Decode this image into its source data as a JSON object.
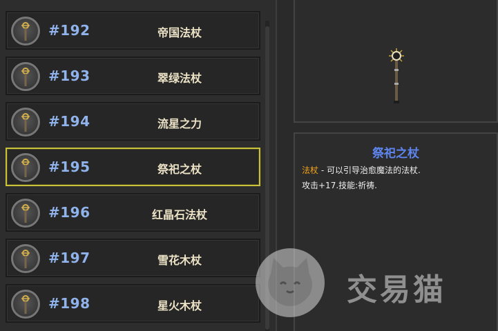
{
  "items": [
    {
      "id": "#192",
      "name": "帝国法杖",
      "icon": "staff-icon",
      "selected": false
    },
    {
      "id": "#193",
      "name": "翠绿法杖",
      "icon": "staff-icon",
      "selected": false
    },
    {
      "id": "#194",
      "name": "流星之力",
      "icon": "staff-icon",
      "selected": false
    },
    {
      "id": "#195",
      "name": "祭祀之杖",
      "icon": "staff-icon",
      "selected": true
    },
    {
      "id": "#196",
      "name": "红晶石法杖",
      "icon": "staff-icon",
      "selected": false
    },
    {
      "id": "#197",
      "name": "雪花木杖",
      "icon": "staff-icon",
      "selected": false
    },
    {
      "id": "#198",
      "name": "星火木杖",
      "icon": "staff-icon",
      "selected": false
    }
  ],
  "detail": {
    "title": "祭祀之杖",
    "type_label": "法杖",
    "description": " - 可以引导治愈魔法的法杖.",
    "stats": "攻击+17.技能:祈祷."
  },
  "watermark": {
    "text": "交易猫"
  },
  "colors": {
    "id_text": "#8fb3ea",
    "name_text": "#ece2c6",
    "selected_border": "#c9c23a",
    "detail_title": "#5f86f0",
    "type_label": "#f2a31a"
  }
}
